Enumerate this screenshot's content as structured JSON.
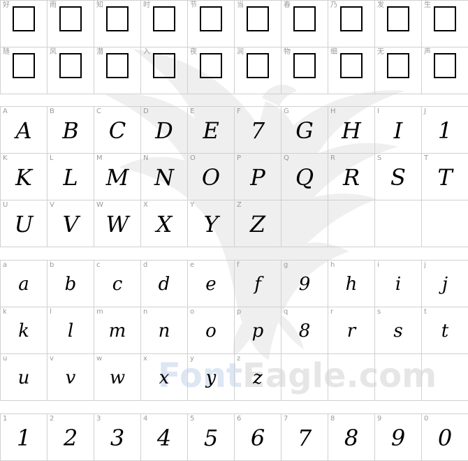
{
  "cjk_rows": [
    [
      "好",
      "雨",
      "知",
      "时",
      "节",
      "当",
      "春",
      "乃",
      "发",
      "生"
    ],
    [
      "随",
      "风",
      "潜",
      "入",
      "夜",
      "润",
      "物",
      "细",
      "无",
      "声"
    ]
  ],
  "uppercase": {
    "labels": [
      "A",
      "B",
      "C",
      "D",
      "E",
      "F",
      "G",
      "H",
      "I",
      "J",
      "K",
      "L",
      "M",
      "N",
      "O",
      "P",
      "Q",
      "R",
      "S",
      "T",
      "U",
      "V",
      "W",
      "X",
      "Y",
      "Z"
    ],
    "glyphs": [
      "A",
      "B",
      "C",
      "D",
      "E",
      "7",
      "G",
      "H",
      "I",
      "1",
      "K",
      "L",
      "M",
      "N",
      "O",
      "P",
      "Q",
      "R",
      "S",
      "T",
      "U",
      "V",
      "W",
      "X",
      "Y",
      "Z"
    ]
  },
  "lowercase": {
    "labels": [
      "a",
      "b",
      "c",
      "d",
      "e",
      "f",
      "g",
      "h",
      "i",
      "j",
      "k",
      "l",
      "m",
      "n",
      "o",
      "p",
      "q",
      "r",
      "s",
      "t",
      "u",
      "v",
      "w",
      "x",
      "y",
      "z"
    ],
    "glyphs": [
      "a",
      "b",
      "c",
      "d",
      "e",
      "f",
      "9",
      "h",
      "i",
      "j",
      "k",
      "l",
      "m",
      "n",
      "o",
      "p",
      "8",
      "r",
      "s",
      "t",
      "u",
      "v",
      "w",
      "x",
      "y",
      "z"
    ]
  },
  "digits": {
    "labels": [
      "1",
      "2",
      "3",
      "4",
      "5",
      "6",
      "7",
      "8",
      "9",
      "0"
    ],
    "glyphs": [
      "1",
      "2",
      "3",
      "4",
      "5",
      "6",
      "7",
      "8",
      "9",
      "0"
    ]
  },
  "watermark": {
    "part1": "Font",
    "part2": "Eagle.com"
  }
}
